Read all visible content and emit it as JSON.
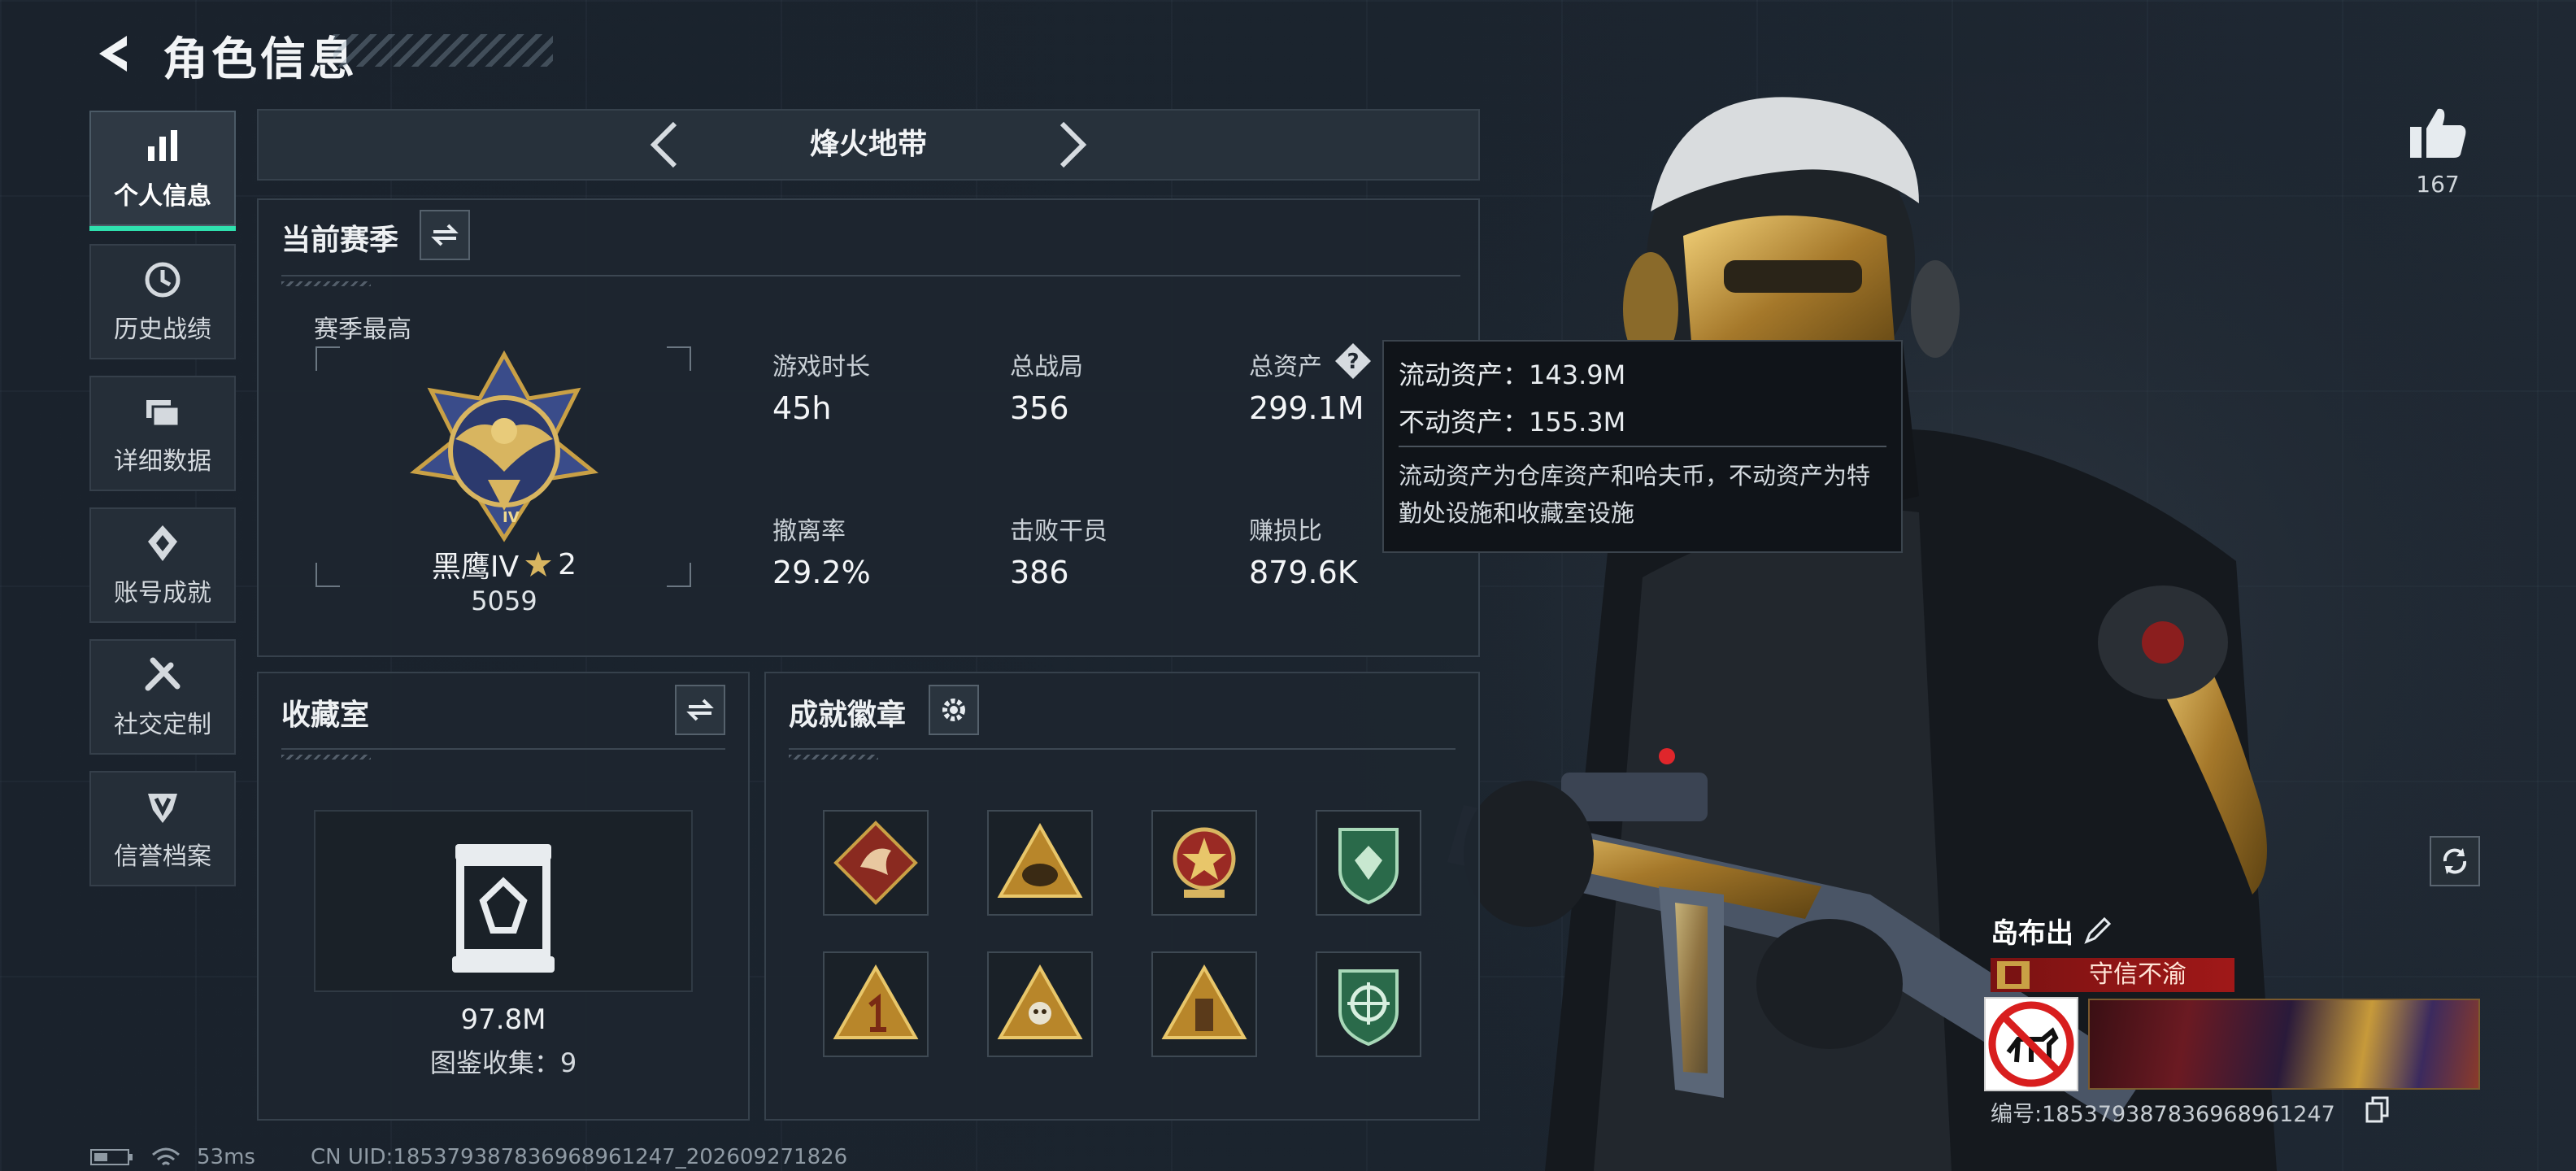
{
  "header": {
    "title": "角色信息"
  },
  "sidebar": {
    "items": [
      {
        "label": "个人信息",
        "icon": "bar-chart-icon",
        "active": true
      },
      {
        "label": "历史战绩",
        "icon": "history-clock-icon",
        "active": false
      },
      {
        "label": "详细数据",
        "icon": "folder-icon",
        "active": false
      },
      {
        "label": "账号成就",
        "icon": "achievement-gem-icon",
        "active": false
      },
      {
        "label": "社交定制",
        "icon": "tools-icon",
        "active": false
      },
      {
        "label": "信誉档案",
        "icon": "shield-v-icon",
        "active": false
      }
    ]
  },
  "mode": {
    "title": "烽火地带"
  },
  "season": {
    "title": "当前赛季",
    "best_label": "赛季最高",
    "rank_name": "黑鹰IV",
    "rank_stars": "2",
    "rank_score": "5059",
    "rank_numeral": "IV"
  },
  "stats": [
    {
      "label": "游戏时长",
      "value": "45h"
    },
    {
      "label": "总战局",
      "value": "356"
    },
    {
      "label": "总资产",
      "value": "299.1M"
    },
    {
      "label": "撤离率",
      "value": "29.2%"
    },
    {
      "label": "击败干员",
      "value": "386"
    },
    {
      "label": "赚损比",
      "value": "879.6K"
    }
  ],
  "tooltip": {
    "liquid": "流动资产：143.9M",
    "fixed": "不动资产：155.3M",
    "desc": "流动资产为仓库资产和哈夫币，不动资产为特勤处设施和收藏室设施"
  },
  "collection": {
    "title": "收藏室",
    "value": "97.8M",
    "count_text": "图鉴收集：9"
  },
  "badges": {
    "title": "成就徽章",
    "items": [
      "dragon-badge-icon",
      "beast-triangle-badge-icon",
      "star-medal-badge-icon",
      "green-gem-badge-icon",
      "number-one-badge-icon",
      "skull-triangle-badge-icon",
      "tower-triangle-badge-icon",
      "green-crosshair-badge-icon"
    ]
  },
  "likes": {
    "count": "167"
  },
  "player": {
    "name": "岛布出",
    "title": "守信不渝",
    "id_text": "编号:185379387836968961247"
  },
  "status_bar": {
    "ping": "53ms",
    "uid": "CN UID:185379387836968961247_202609271826"
  },
  "colors": {
    "accent": "#2fe0ae",
    "gold": "#c9a045",
    "title_red": "#a01818"
  }
}
